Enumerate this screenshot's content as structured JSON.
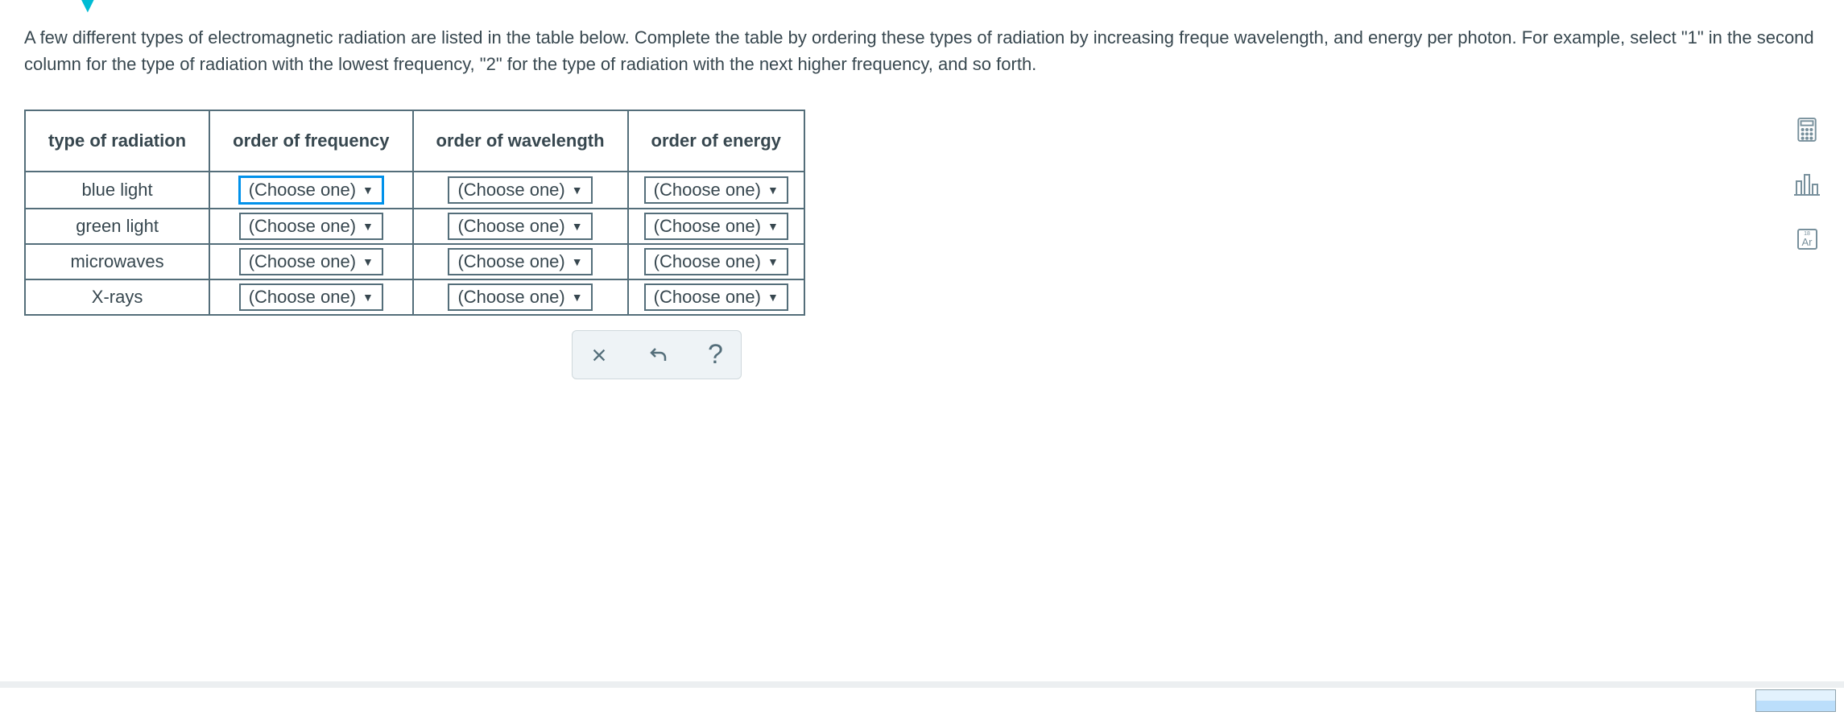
{
  "instructions": "A few different types of electromagnetic radiation are listed in the table below. Complete the table by ordering these types of radiation by increasing freque wavelength, and energy per photon. For example, select \"1\" in the second column for the type of radiation with the lowest frequency, \"2\" for the type of radiation with the next higher frequency, and so forth.",
  "table": {
    "headers": {
      "type": "type of radiation",
      "frequency": "order of frequency",
      "wavelength": "order of wavelength",
      "energy": "order of energy"
    },
    "rows": [
      {
        "type": "blue light",
        "frequency": "(Choose one)",
        "wavelength": "(Choose one)",
        "energy": "(Choose one)"
      },
      {
        "type": "green light",
        "frequency": "(Choose one)",
        "wavelength": "(Choose one)",
        "energy": "(Choose one)"
      },
      {
        "type": "microwaves",
        "frequency": "(Choose one)",
        "wavelength": "(Choose one)",
        "energy": "(Choose one)"
      },
      {
        "type": "X-rays",
        "frequency": "(Choose one)",
        "wavelength": "(Choose one)",
        "energy": "(Choose one)"
      }
    ],
    "focused_cell": {
      "row": 0,
      "col": "frequency"
    }
  },
  "tools": {
    "periodic": {
      "num": "18",
      "symbol": "Ar"
    }
  }
}
